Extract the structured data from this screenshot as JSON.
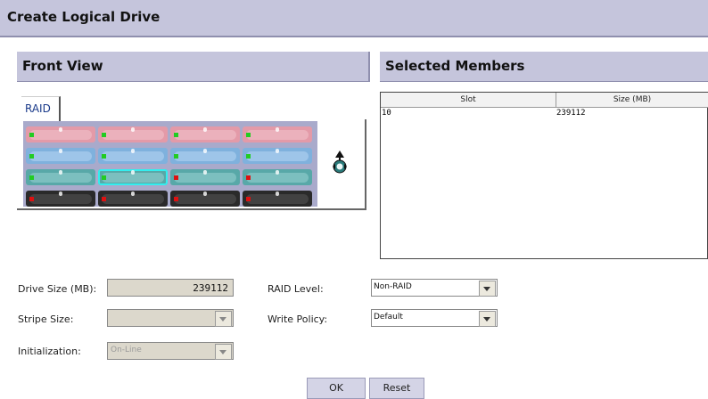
{
  "page": {
    "title": "Create Logical Drive"
  },
  "front_view": {
    "title": "Front View",
    "tab_label": "RAID",
    "enclosure": {
      "rows": [
        {
          "color": "#e39aa8",
          "tray": "#f2c4cc",
          "leds": [
            "#22cc22",
            "#22cc22",
            "#22cc22",
            "#22cc22"
          ]
        },
        {
          "color": "#7fb1dd",
          "tray": "#b8d6f2",
          "leds": [
            "#22cc22",
            "#22cc22",
            "#22cc22",
            "#22cc22"
          ]
        },
        {
          "color": "#58a8a8",
          "tray": "#9bd1d1",
          "leds": [
            "#22cc22",
            "#22cc22",
            "#dd1111",
            "#dd1111"
          ]
        },
        {
          "color": "#2a2a2a",
          "tray": "#555555",
          "leds": [
            "#dd1111",
            "#dd1111",
            "#dd1111",
            "#dd1111"
          ]
        }
      ],
      "selected_bay": "row 3, bay 2"
    },
    "locate_icon": "locate-enclosure-icon"
  },
  "selected_members": {
    "title": "Selected Members",
    "columns": [
      "Slot",
      "Size (MB)"
    ],
    "rows": [
      {
        "slot": "10",
        "size": "239112"
      }
    ]
  },
  "form": {
    "drive_size_label": "Drive Size (MB):",
    "drive_size_value": "239112",
    "stripe_size_label": "Stripe Size:",
    "stripe_size_value": "",
    "initialization_label": "Initialization:",
    "initialization_value": "On-Line",
    "raid_level_label": "RAID Level:",
    "raid_level_value": "Non-RAID",
    "write_policy_label": "Write Policy:",
    "write_policy_value": "Default"
  },
  "buttons": {
    "ok": "OK",
    "reset": "Reset"
  },
  "colors": {
    "header_bg": "#c5c5dc",
    "enclosure_bg": "#a9aacb",
    "selected_outline": "#33eeee"
  }
}
